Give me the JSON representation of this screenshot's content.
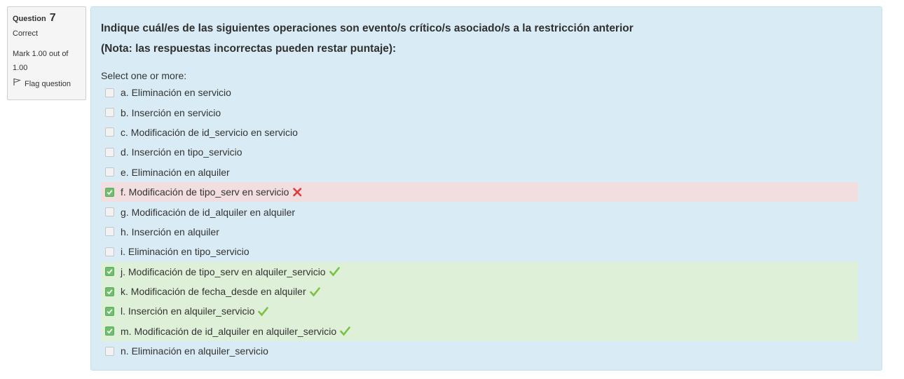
{
  "info": {
    "question_label": "Question",
    "question_number": "7",
    "state": "Correct",
    "grade": "Mark 1.00 out of 1.00",
    "flag_label": "Flag question"
  },
  "question": {
    "text_line1": "Indique cuál/es de las siguientes operaciones son evento/s crítico/s asociado/s a la restricción anterior",
    "text_line2": "(Nota: las respuestas incorrectas pueden restar puntaje):",
    "prompt": "Select one or more:"
  },
  "options": [
    {
      "label": "a. Eliminación en servicio",
      "checked": false,
      "result": "none"
    },
    {
      "label": "b. Inserción en servicio",
      "checked": false,
      "result": "none"
    },
    {
      "label": "c. Modificación de id_servicio en servicio",
      "checked": false,
      "result": "none"
    },
    {
      "label": "d. Inserción en tipo_servicio",
      "checked": false,
      "result": "none"
    },
    {
      "label": "e. Eliminación en alquiler",
      "checked": false,
      "result": "none"
    },
    {
      "label": "f. Modificación de tipo_serv en servicio",
      "checked": true,
      "result": "incorrect"
    },
    {
      "label": "g. Modificación de id_alquiler en alquiler",
      "checked": false,
      "result": "none"
    },
    {
      "label": "h. Inserción en alquiler",
      "checked": false,
      "result": "none"
    },
    {
      "label": "i. Eliminación en tipo_servicio",
      "checked": false,
      "result": "none"
    },
    {
      "label": "j. Modificación de tipo_serv en alquiler_servicio",
      "checked": true,
      "result": "correct"
    },
    {
      "label": "k. Modificación de fecha_desde en alquiler",
      "checked": true,
      "result": "correct"
    },
    {
      "label": "l. Inserción en alquiler_servicio",
      "checked": true,
      "result": "correct"
    },
    {
      "label": "m. Modificación de id_alquiler en alquiler_servicio",
      "checked": true,
      "result": "correct"
    },
    {
      "label": "n. Eliminación en alquiler_servicio",
      "checked": false,
      "result": "none"
    }
  ],
  "colors": {
    "panel_bg": "#d9ecf5",
    "incorrect_bg": "#f2dede",
    "correct_bg": "#dff0d8",
    "checkbox_checked": "#6fbf6f",
    "tick_green": "#7ac143",
    "cross_red": "#e0393e"
  },
  "icons": {
    "flag": "flag-icon",
    "correct": "check-icon",
    "incorrect": "cross-icon",
    "checkbox_checked": "checkbox-checked-icon"
  }
}
